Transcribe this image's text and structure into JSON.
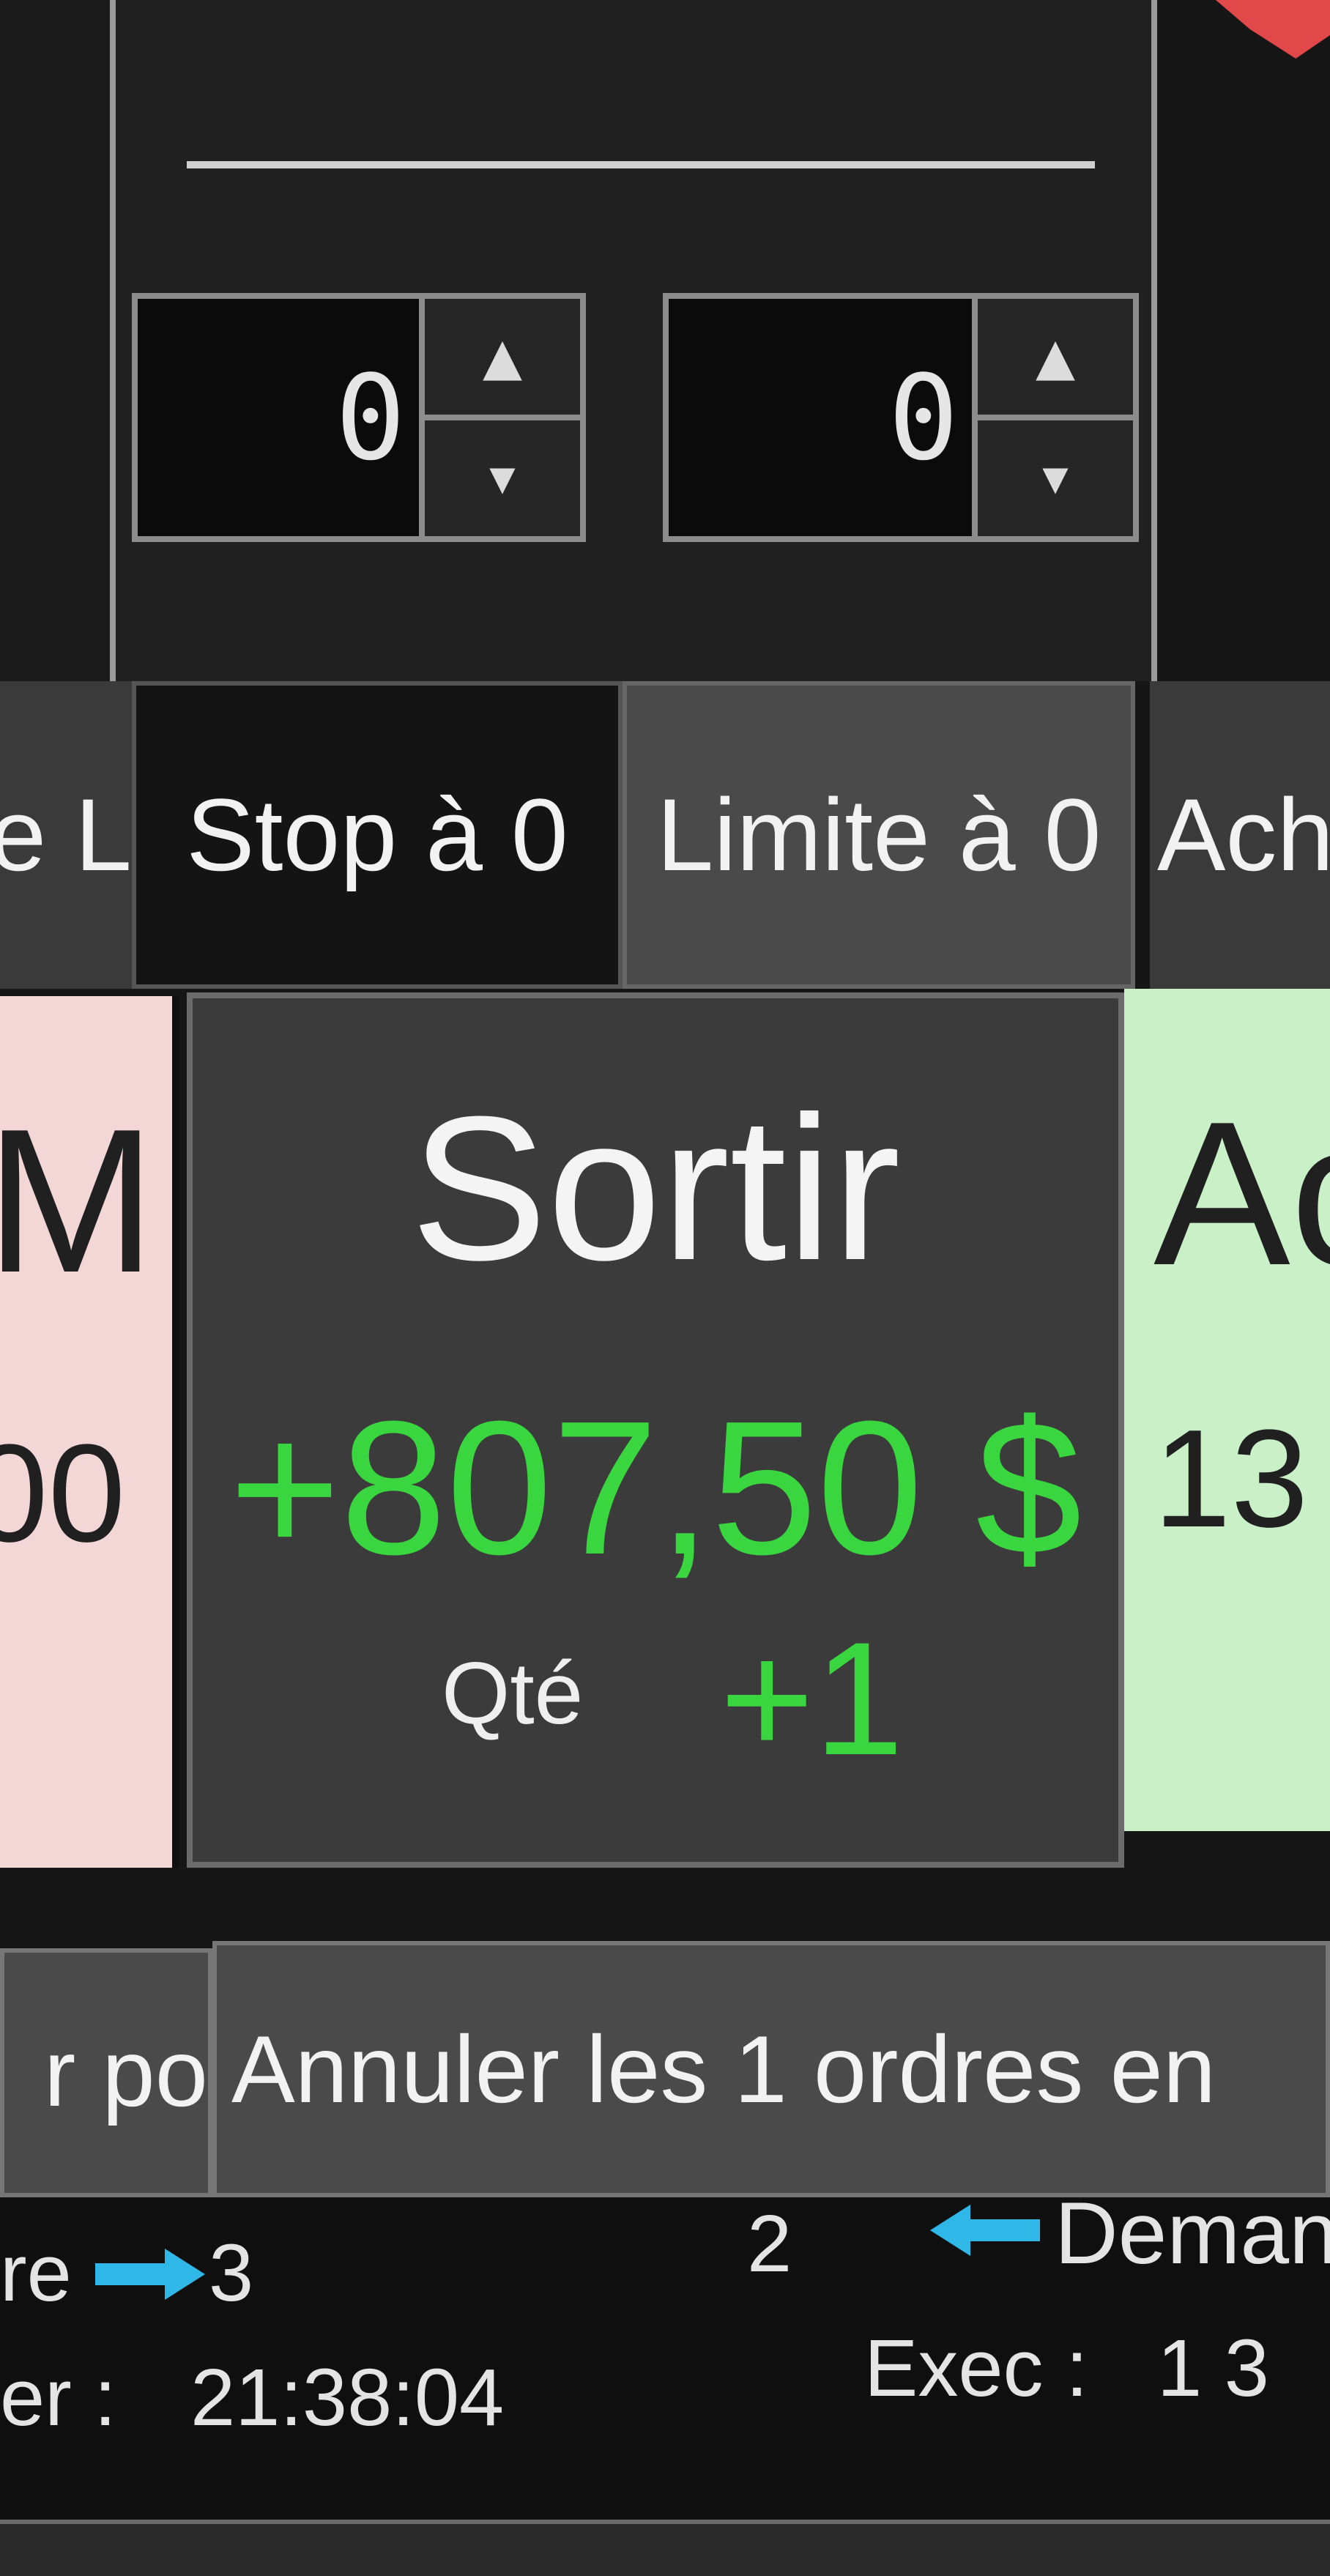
{
  "qty_inputs": [
    {
      "value": "0",
      "up": "▲",
      "down": "▼"
    },
    {
      "value": "0",
      "up": "▲",
      "down": "▼"
    }
  ],
  "buttons": {
    "left_partial": "e L",
    "stop": "Stop à 0",
    "limit": "Limite à 0",
    "right_partial": "Ach"
  },
  "left_panel": {
    "letter": "M",
    "value": "00"
  },
  "center_panel": {
    "title": "Sortir",
    "pnl": "+807,50 $",
    "qty_label": "Qté",
    "qty_value": "+1"
  },
  "right_panel": {
    "letter": "Ac",
    "value": "13"
  },
  "cancel": {
    "left_partial": "r po",
    "main": "Annuler les 1 ordres en"
  },
  "status": {
    "left_partial": "re",
    "left_count": "3",
    "mid_count": "2",
    "right_label": "Deman",
    "time_label": "er :",
    "time": "21:38:04",
    "exec_label": "Exec :",
    "exec_value": "1 3"
  },
  "colors": {
    "profit": "#39d63f",
    "arrow": "#2fb7e8",
    "sell_panel": "#f3d6d6",
    "buy_panel": "#c9f0c7"
  }
}
